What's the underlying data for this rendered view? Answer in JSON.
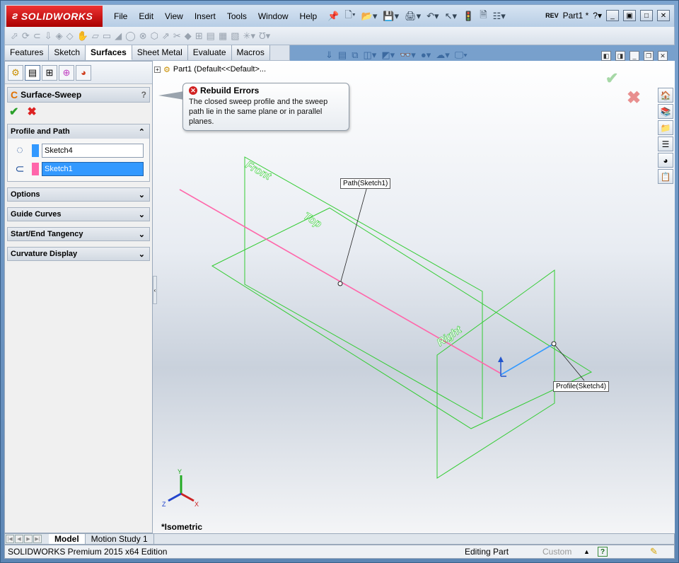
{
  "app": {
    "logo": "SOLIDWORKS",
    "doc_title": "Part1 *",
    "rev": "REV"
  },
  "menu": [
    "File",
    "Edit",
    "View",
    "Insert",
    "Tools",
    "Window",
    "Help"
  ],
  "cm_tabs": [
    {
      "label": "Features",
      "active": false
    },
    {
      "label": "Sketch",
      "active": false
    },
    {
      "label": "Surfaces",
      "active": true
    },
    {
      "label": "Sheet Metal",
      "active": false
    },
    {
      "label": "Evaluate",
      "active": false
    },
    {
      "label": "Macros",
      "active": false
    }
  ],
  "tree_flyout": {
    "label": "Part1  (Default<<Default>..."
  },
  "property_manager": {
    "title": "Surface-Sweep",
    "help": "?",
    "groups": {
      "profile_path": {
        "title": "Profile and Path",
        "profile_value": "Sketch4",
        "path_value": "Sketch1"
      }
    },
    "collapsed_groups": [
      "Options",
      "Guide Curves",
      "Start/End Tangency",
      "Curvature Display"
    ]
  },
  "error": {
    "title": "Rebuild Errors",
    "message": "The closed sweep profile and the sweep path lie in the same plane or in parallel planes."
  },
  "scene": {
    "planes": {
      "front": "Front",
      "top": "Top",
      "right": "Right"
    },
    "path_label": "Path(Sketch1)",
    "profile_label": "Profile(Sketch4)",
    "view_name": "*Isometric",
    "axes": {
      "x": "X",
      "y": "Y",
      "z": "Z"
    }
  },
  "bottom_tabs": [
    {
      "label": "Model",
      "active": true
    },
    {
      "label": "Motion Study 1",
      "active": false
    }
  ],
  "status": {
    "edition": "SOLIDWORKS Premium 2015 x64 Edition",
    "mode": "Editing Part",
    "units": "Custom"
  },
  "colors": {
    "plane": "#33cc33",
    "path": "#ff66aa",
    "profile": "#3399ff",
    "brand": "#cc1111"
  }
}
